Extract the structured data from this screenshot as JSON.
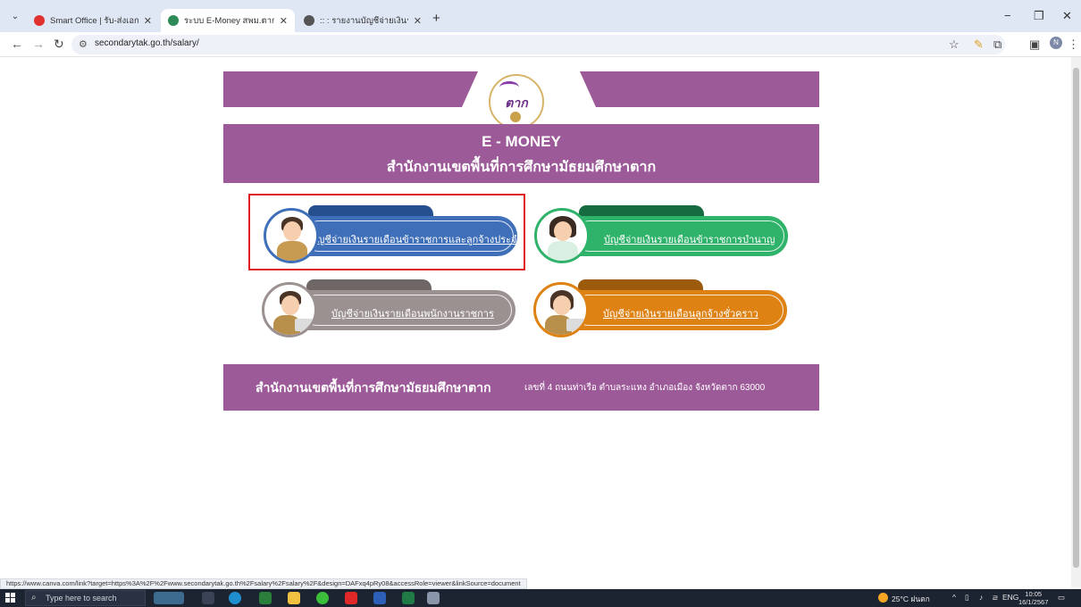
{
  "browser": {
    "tabs": [
      {
        "title": "Smart Office | รับ-ส่งเอกสาร - แนะ",
        "close": "✕",
        "favicon_color": "#e0312e"
      },
      {
        "title": "ระบบ E-Money สพม.ตาก",
        "close": "✕",
        "favicon_color": "#2e8b57"
      },
      {
        "title": ":: : รายงานบัญชีจ่ายเงินรายเดือน",
        "close": "✕",
        "favicon_color": "#555555"
      }
    ],
    "new_tab": "+",
    "url": "secondarytak.go.th/salary/",
    "status_url": "https://www.canva.com/link?target=https%3A%2F%2Fwww.secondarytak.go.th%2Fsalary%2Fsalary%2F&design=DAFxq4pRy08&accessRole=viewer&linkSource=document"
  },
  "page": {
    "logo_text": "ตาก",
    "title": "E - MONEY",
    "office": "สำนักงานเขตพื้นที่การศึกษามัธยมศึกษาตาก",
    "menu": [
      {
        "label": "บัญชีจ่ายเงินรายเดือนข้าราชการและลูกจ้างประจำ",
        "color": "#3f6fb8",
        "tab_color": "#264f8f"
      },
      {
        "label": "บัญชีจ่ายเงินรายเดือนข้าราชการบำนาญ",
        "color": "#2fb26a",
        "tab_color": "#176b40"
      },
      {
        "label": "บัญชีจ่ายเงินรายเดือนพนักงานราชการ",
        "color": "#9c9191",
        "tab_color": "#6f6666"
      },
      {
        "label": "บัญชีจ่ายเงินรายเดือนลูกจ้างชั่วคราว",
        "color": "#de8214",
        "tab_color": "#9c5a0c"
      }
    ],
    "footer_name": "สำนักงานเขตพื้นที่การศึกษามัธยมศึกษาตาก",
    "footer_address": "เลขที่ 4 ถนนท่าเรือ ตำบลระแหง อำเภอเมือง จังหวัดตาก 63000"
  },
  "taskbar": {
    "search_placeholder": "Type here to search",
    "weather": "25°C ฝนตก",
    "lang": "ENG",
    "time": "10:05",
    "date": "16/1/2567"
  }
}
